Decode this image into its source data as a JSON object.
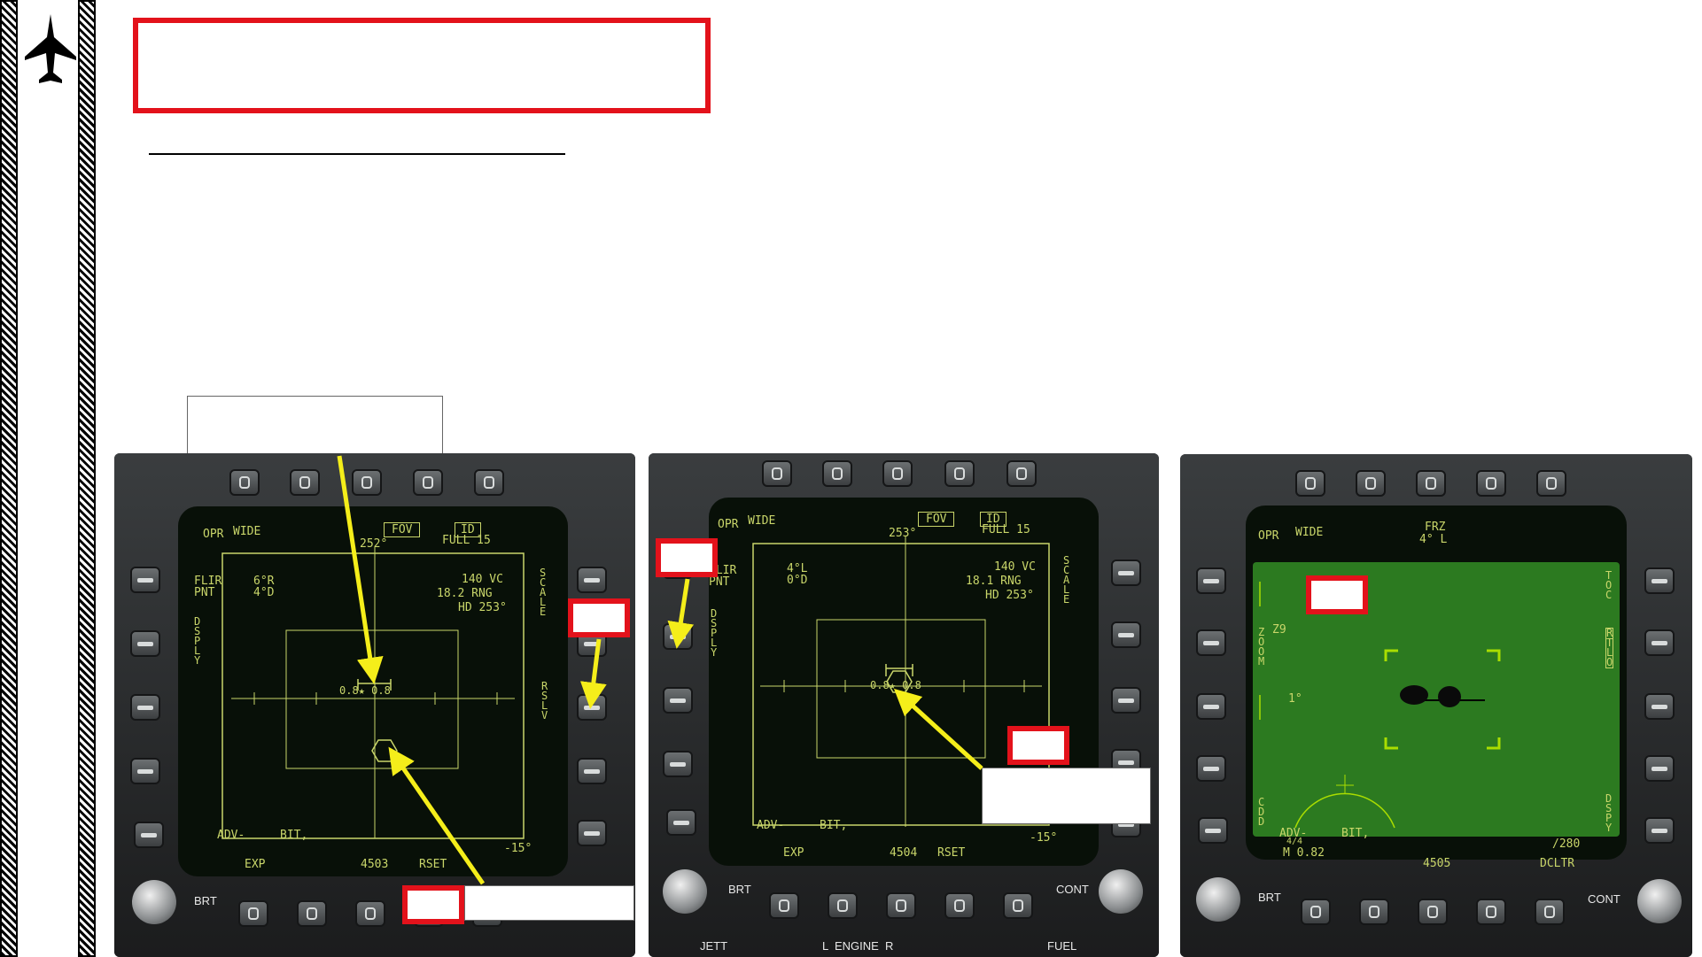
{
  "side": {
    "icon": "fighter-jet-icon"
  },
  "panel1": {
    "top": {
      "opr": "OPR",
      "wide": "WIDE",
      "fov": "FOV",
      "id": "ID",
      "full": "FULL 15",
      "hdg": "252°"
    },
    "left": {
      "flir": "FLIR",
      "pnt": "PNT",
      "dsply": "D\nS\nP\nL\nY",
      "rng_l": "6°R\n4°D"
    },
    "right": {
      "vc": "140 VC",
      "rng": "18.2 RNG",
      "hd": "HD 253°",
      "scale": "S\nC\nA\nL\nE",
      "rsfly": "R\nS\nL\nV"
    },
    "target": "0.8★ 0.8",
    "bottom": {
      "adv": "ADV-",
      "bit": "BIT,",
      "neg15": "-15°",
      "exp": "EXP",
      "code": "4503",
      "rset": "RSET",
      "brt": "BRT"
    }
  },
  "panel2": {
    "top": {
      "opr": "OPR",
      "wide": "WIDE",
      "fov": "FOV",
      "id": "ID",
      "full": "FULL 15",
      "hdg": "253°"
    },
    "left": {
      "flir": "FLIR",
      "pnt": "PNT",
      "dsply": "D\nS\nP\nL\nY",
      "rng_l": "4°L\n0°D"
    },
    "right": {
      "vc": "140 VC",
      "rng": "18.1 RNG",
      "hd": "HD 253°",
      "scale": "S\nC\nA\nL\nE"
    },
    "target": "0.8★ 0.8",
    "bottom": {
      "adv": "ADV-",
      "bit": "BIT,",
      "neg15": "-15°",
      "exp": "EXP",
      "code": "4504",
      "rset": "RSET",
      "brt": "BRT",
      "cont": "CONT",
      "jett": "JETT",
      "engine": "L  ENGINE  R",
      "fuel": "FUEL"
    }
  },
  "panel3": {
    "top": {
      "opr": "OPR",
      "wide": "WIDE",
      "frz": "FRZ",
      "angle": "4° L"
    },
    "left": {
      "z9": "Z9",
      "zoom": "Z\nO\nO\nM",
      "one": "1°",
      "cdd": "C\nD\nD"
    },
    "right": {
      "toc": "T\nO\nC",
      "ritp": "R\nT\nL\nO",
      "dspy": "D\nS\nP\nY"
    },
    "bottom": {
      "adv": "ADV-",
      "bit": "BIT,",
      "ratio": "4/4",
      "mach": "M 0.82",
      "alt": "/280",
      "code": "4505",
      "dcltr": "DCLTR",
      "brt": "BRT",
      "cont": "CONT"
    }
  },
  "colors": {
    "accent_red": "#e3121b",
    "arrow_yellow": "#f5ee1a",
    "symbology": "#c9d66a",
    "flir_green": "#2c7a20"
  }
}
